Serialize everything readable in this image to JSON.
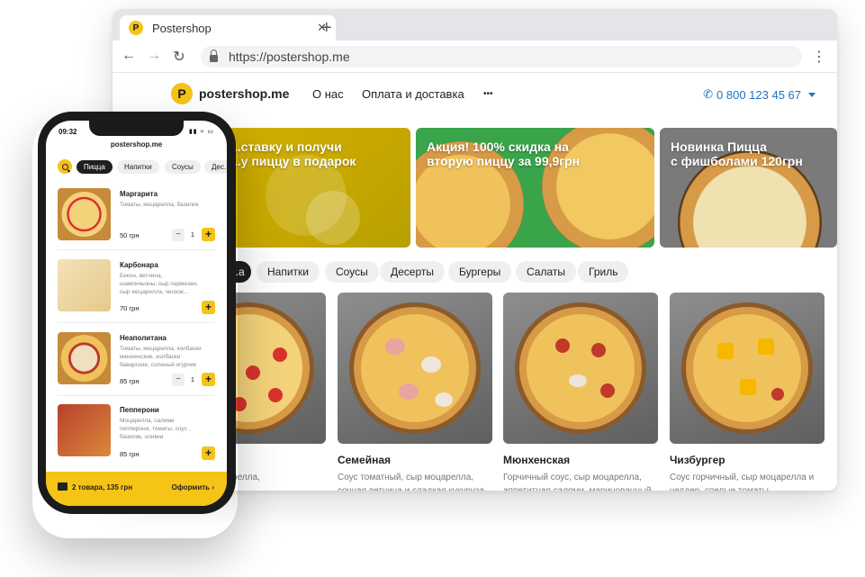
{
  "browser": {
    "tab_title": "Postershop",
    "favicon_letter": "P",
    "url": "https://postershop.me"
  },
  "site": {
    "logo_letter": "P",
    "logo_text": "postershop.me",
    "nav": [
      "О нас",
      "Оплата и доставка",
      "•••"
    ],
    "phone": "0 800 123 45 67"
  },
  "banners": [
    "...ставку и получи\n...у пиццу в подарок",
    "Акция! 100% скидка на\nвторую пиццу за 99,9грн",
    "Новинка Пицца\nс фишболами 120грн"
  ],
  "categories": [
    "...а",
    "Напитки",
    "Соусы",
    "Десерты",
    "Бургеры",
    "Салаты",
    "Гриль"
  ],
  "products": [
    {
      "name": "...она",
      "desc": "...ус, сыр моцарелла,\n...л, грибы ..."
    },
    {
      "name": "Семейная",
      "desc": "Соус томатный, сыр моцарелла,\nсочная ветчина и сладкая кукуруза,"
    },
    {
      "name": "Мюнхенская",
      "desc": "Горчичный соус, сыр моцарелла,\nаппетитная салями, маринованный"
    },
    {
      "name": "Чизбургер",
      "desc": "Соус горчичный, сыр моцарелла и\nчеддер, спелые томаты ..."
    }
  ],
  "mobile": {
    "time": "09:32",
    "status_icons": "▮▮ ≈ ▭",
    "title": "postershop.me",
    "categories": [
      "Пицца",
      "Напитки",
      "Соусы",
      "Дес..."
    ],
    "items": [
      {
        "name": "Маргарита",
        "desc": "Томаты, моцарелла, базилик",
        "price": "50 грн",
        "qty": "1"
      },
      {
        "name": "Карбонара",
        "desc": "Бекон, ветчина,\nшампиньоны, сыр пармезан,\nсыр моцарелла, чеснок...",
        "price": "70 грн",
        "qty": ""
      },
      {
        "name": "Неаполитана",
        "desc": "Томаты, моцарелла, колбаски\nмюнхенские, колбаски\nбаварские, соленый огурчик",
        "price": "85 грн",
        "qty": "1"
      },
      {
        "name": "Пепперони",
        "desc": "Моцарелла, салями\nпепперони, томаты, соус ,\nбазилик, оливки",
        "price": "85 грн",
        "qty": ""
      }
    ],
    "cart_summary": "2 товара, 135 грн",
    "checkout_label": "Оформить"
  },
  "colors": {
    "accent": "#f6c317",
    "phone_link": "#1a73c8",
    "dark": "#1f1f1f"
  }
}
